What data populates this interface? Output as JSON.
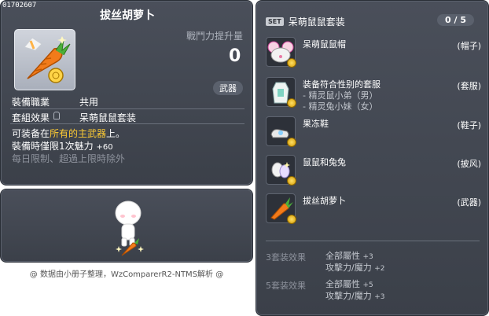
{
  "item": {
    "id": "01702607",
    "name": "拔丝胡萝卜",
    "power_label": "戰鬥力提升量",
    "power_value": "0",
    "tag": "武器",
    "job_label": "裝備職業",
    "job_value": "共用",
    "set_label": "套組效果",
    "set_value": "呆萌鼠鼠套装",
    "desc_prefix": "可装备在",
    "desc_highlight": "所有的主武器",
    "desc_suffix": "上。",
    "charm_label": "裝備時僅限1次魅力",
    "charm_value": "+60",
    "limit_text": "每日限制、超過上限時除外"
  },
  "caption": "@ 数据由小册子整理，WzComparerR2-NTMS解析 @",
  "set": {
    "badge": "SET",
    "title": "呆萌鼠鼠套装",
    "count": "0 / 5",
    "pieces": [
      {
        "name": [
          "呆萌鼠鼠帽"
        ],
        "type": "(帽子)",
        "icon": "mouse-hat-icon"
      },
      {
        "name": [
          "装备符合性别的套服",
          "- 精灵鼠小弟（男）",
          "- 精灵兔小妹（女）"
        ],
        "type": "(套服)",
        "icon": "overall-icon"
      },
      {
        "name": [
          "果冻鞋"
        ],
        "type": "(鞋子)",
        "icon": "jelly-shoes-icon"
      },
      {
        "name": [
          "鼠鼠和兔兔"
        ],
        "type": "(披风)",
        "icon": "cape-icon"
      },
      {
        "name": [
          "拔丝胡萝卜"
        ],
        "type": "(武器)",
        "icon": "carrot-icon"
      }
    ],
    "bonuses": [
      {
        "label": "3套装效果",
        "lines": [
          {
            "t": "全部屬性",
            "v": "+3"
          },
          {
            "t": "攻擊力/魔力",
            "v": "+2"
          }
        ]
      },
      {
        "label": "5套装效果",
        "lines": [
          {
            "t": "全部屬性",
            "v": "+5"
          },
          {
            "t": "攻擊力/魔力",
            "v": "+3"
          }
        ]
      }
    ]
  },
  "colors": {
    "panel": "#40454f",
    "highlight": "#ffcc33",
    "muted": "#8d929c"
  }
}
